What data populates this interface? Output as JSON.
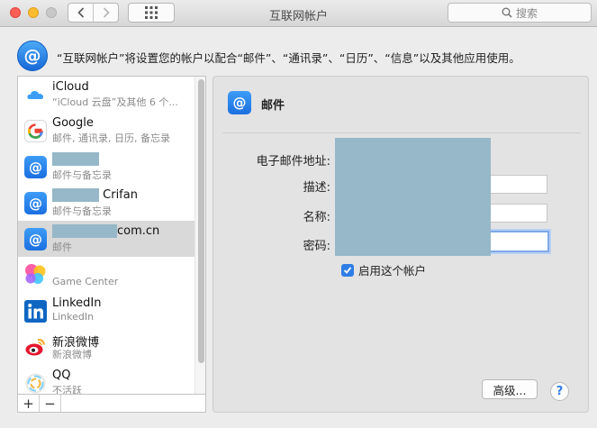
{
  "window": {
    "title": "互联网帐户",
    "search_placeholder": "搜索"
  },
  "header": {
    "description": "“互联网帐户”将设置您的帐户以配合“邮件”、“通讯录”、“日历”、“信息”以及其他应用使用。"
  },
  "sidebar": {
    "items": [
      {
        "name": "iCloud",
        "sub": "“iCloud 云盘”及其他 6 个...",
        "icon": "icloud-icon"
      },
      {
        "name": "Google",
        "sub": "邮件, 通讯录, 日历, 备忘录",
        "icon": "google-icon"
      },
      {
        "name": "",
        "sub": "邮件与备忘录",
        "icon": "mail-at-icon"
      },
      {
        "name": "Crifan",
        "sub": "邮件与备忘录",
        "icon": "mail-at-icon"
      },
      {
        "name": "com.cn",
        "sub": "邮件",
        "icon": "mail-at-icon",
        "selected": true
      },
      {
        "name": "",
        "sub": "Game Center",
        "icon": "game-center-icon"
      },
      {
        "name": "LinkedIn",
        "sub": "LinkedIn",
        "icon": "linkedin-icon"
      },
      {
        "name": "新浪微博",
        "sub": "新浪微博",
        "icon": "weibo-icon"
      },
      {
        "name": "QQ",
        "sub": "不活跃",
        "icon": "qq-icon"
      }
    ],
    "add_label": "+",
    "remove_label": "−"
  },
  "detail": {
    "title": "邮件",
    "fields": {
      "email_label": "电子邮件地址:",
      "description_label": "描述:",
      "name_label": "名称:",
      "password_label": "密码:"
    },
    "enable_label": "启用这个帐户",
    "enabled": true,
    "advanced_label": "高级...",
    "help_label": "?"
  }
}
